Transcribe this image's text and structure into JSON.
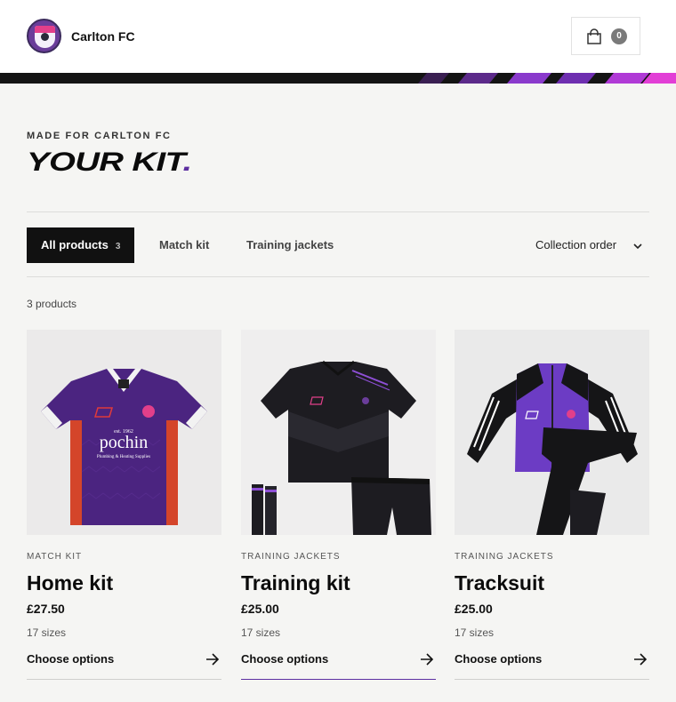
{
  "header": {
    "club_name": "Carlton FC",
    "cart_count": "0"
  },
  "hero": {
    "eyebrow": "MADE FOR CARLTON FC",
    "title": "YOUR KIT",
    "title_dot": "."
  },
  "filters": {
    "items": [
      {
        "label": "All products",
        "count": "3",
        "active": true
      },
      {
        "label": "Match kit",
        "active": false
      },
      {
        "label": "Training jackets",
        "active": false
      }
    ],
    "sort_label": "Collection order"
  },
  "results": {
    "count_label": "3 products"
  },
  "products": [
    {
      "category": "MATCH KIT",
      "name": "Home kit",
      "price": "£27.50",
      "sizes": "17 sizes",
      "cta": "Choose options",
      "sponsor_small": "est. 1962",
      "sponsor": "pochin",
      "sponsor_tag": "Plumbing & Heating Supplies"
    },
    {
      "category": "TRAINING JACKETS",
      "name": "Training kit",
      "price": "£25.00",
      "sizes": "17 sizes",
      "cta": "Choose options"
    },
    {
      "category": "TRAINING JACKETS",
      "name": "Tracksuit",
      "price": "£25.00",
      "sizes": "17 sizes",
      "cta": "Choose options"
    }
  ],
  "colors": {
    "accent": "#5c2fa0",
    "brand_pink": "#e23fd6",
    "dark": "#111111"
  },
  "icons": {
    "cart": "shopping-bag-icon",
    "sort": "chevron-down-icon",
    "cta": "arrow-right-icon"
  }
}
